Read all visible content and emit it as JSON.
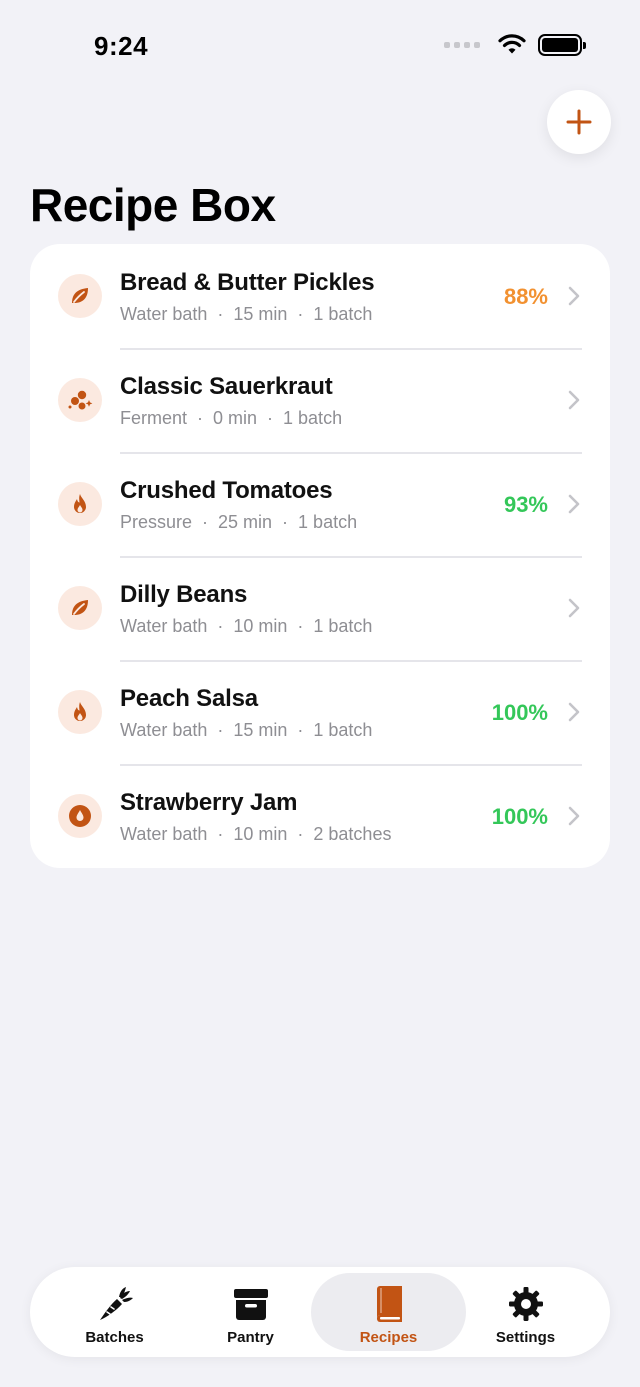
{
  "status_bar": {
    "time": "9:24"
  },
  "header": {
    "title": "Recipe Box",
    "add_icon": "plus-icon",
    "accent_color": "#c25414"
  },
  "recipes": [
    {
      "name": "Bread & Butter Pickles",
      "method": "Water bath",
      "time": "15 min",
      "yield": "1 batch",
      "percent": "88%",
      "percent_color": "#f29130",
      "icon": "leaf-icon"
    },
    {
      "name": "Classic Sauerkraut",
      "method": "Ferment",
      "time": "0 min",
      "yield": "1 batch",
      "percent": "",
      "percent_color": "",
      "icon": "bubbles-icon"
    },
    {
      "name": "Crushed Tomatoes",
      "method": "Pressure",
      "time": "25 min",
      "yield": "1 batch",
      "percent": "93%",
      "percent_color": "#34c759",
      "icon": "flame-icon"
    },
    {
      "name": "Dilly Beans",
      "method": "Water bath",
      "time": "10 min",
      "yield": "1 batch",
      "percent": "",
      "percent_color": "",
      "icon": "leaf-icon"
    },
    {
      "name": "Peach Salsa",
      "method": "Water bath",
      "time": "15 min",
      "yield": "1 batch",
      "percent": "100%",
      "percent_color": "#34c759",
      "icon": "flame-icon"
    },
    {
      "name": "Strawberry Jam",
      "method": "Water bath",
      "time": "10 min",
      "yield": "2 batches",
      "percent": "100%",
      "percent_color": "#34c759",
      "icon": "drop-icon"
    }
  ],
  "tabs": [
    {
      "label": "Batches",
      "icon": "carrot-icon",
      "active": false
    },
    {
      "label": "Pantry",
      "icon": "archive-box-icon",
      "active": false
    },
    {
      "label": "Recipes",
      "icon": "book-icon",
      "active": true
    },
    {
      "label": "Settings",
      "icon": "gear-icon",
      "active": false
    }
  ]
}
